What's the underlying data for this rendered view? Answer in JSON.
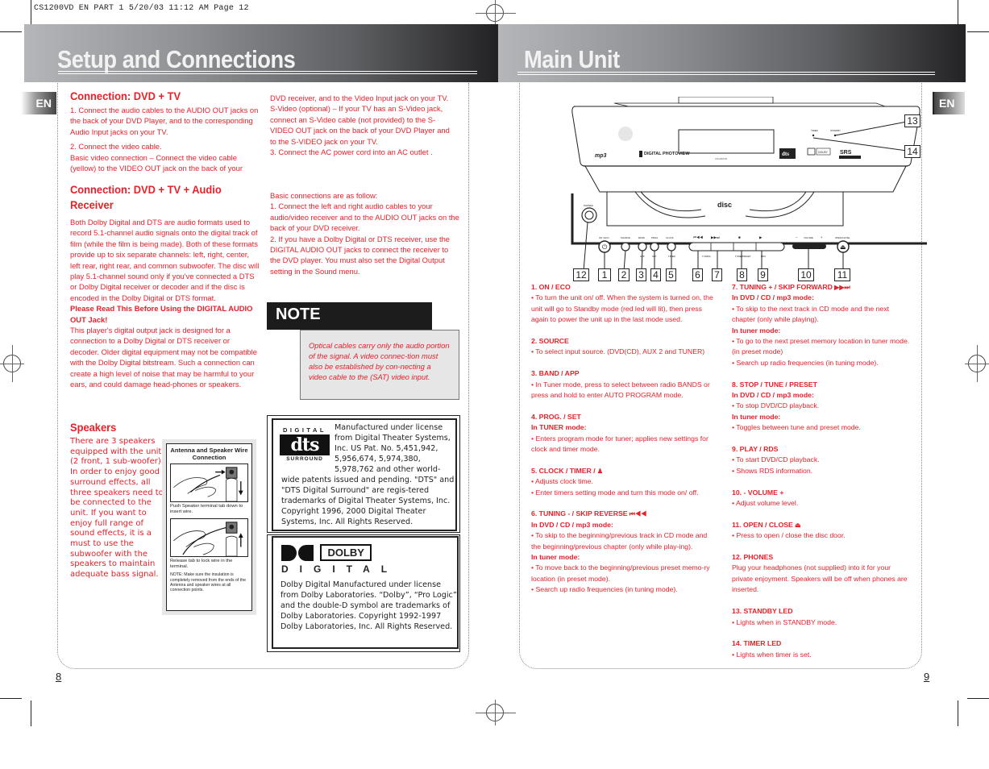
{
  "slug": "CS1200VD EN PART 1  5/20/03  11:12 AM  Page 12",
  "left_page": {
    "title": "Setup and Connections",
    "lang_tab": "EN",
    "page_number": "8",
    "dvd_tv": {
      "heading": "Connection: DVD + TV",
      "step1": "1.  Connect the audio cables to the AUDIO OUT jacks on the back of your DVD Player, and to the corresponding Audio Input jacks on your TV.",
      "step2_title": "2. Connect the video cable.",
      "step2_body": "Basic video connection – Connect the video cable (yellow) to the VIDEO OUT jack on the back of your",
      "cont_1": "DVD receiver, and to the Video Input jack on your TV.",
      "cont_2": "S-Video (optional) – If your TV has an S-Video jack, connect an S-Video cable (not provided) to the S-VIDEO OUT jack on the back of your DVD Player and to the S-VIDEO jack on your TV.",
      "cont_3": "3. Connect the AC power cord into an AC outlet ."
    },
    "dvd_tv_audio": {
      "heading_line1": "Connection: DVD + TV + Audio",
      "heading_line2": "Receiver",
      "body": "Both Dolby Digital and DTS are audio formats used to record 5.1-channel audio signals onto the digital track of film (while the film is being made). Both of these formats provide up to six separate channels: left, right, center, left rear, right rear, and common subwoofer. The disc will play 5.1-channel sound only if you've connected a DTS or Dolby Digital receiver or decoder and if the disc is encoded in the Dolby Digital or DTS format.",
      "warning_title": "Please Read This Before Using the DIGITAL AUDIO OUT Jack!",
      "warning_body": "This player's digital output jack is designed for a connection to a Dolby Digital or DTS receiver or decoder. Older digital equipment may not be compatible with the Dolby Digital bitstream. Such a connection can create a high level of noise that may be harmful to your ears, and could damage head-phones or speakers.",
      "basic_title": "Basic connections are as follow:",
      "basic_1": "1. Connect the left and right audio cables to your audio/video receiver and to the AUDIO OUT jacks on the back of your DVD receiver.",
      "basic_2": "2. If you have a Dolby Digital or DTS receiver, use the DIGITAL AUDIO OUT jacks to connect the receiver to the DVD player. You must also set the Digital Output setting in the Sound menu."
    },
    "note": {
      "label": "NOTE",
      "text": "Optical cables carry only the audio portion of the signal. A video connec-tion must also be established by con-necting a video cable to the (SAT) video input."
    },
    "speakers": {
      "heading": "Speakers",
      "body": "There are 3 speakers equipped with the unit (2 front, 1 sub-woofer).  In order to enjoy good surround effects, all three speakers need to be connected to the unit. If you want to enjoy full range of sound effects, it is a must to use the subwoofer with the  speakers to maintain adequate bass signal."
    },
    "wire_box": {
      "title": "Antenna and Speaker Wire Connection",
      "caption1": "Push Speaker terminal tab down to insert wire.",
      "caption2": "Release tab to lock wire in the terminal.",
      "note": "NOTE: Make sure the insulation is completely removed from the ends of the Antenna and speaker wires at all connection points."
    },
    "dts_license": {
      "logo_top": "DIGITAL",
      "logo_mid": "dts",
      "logo_bottom": "SURROUND",
      "text_top": "Manufactured under license from Digital Theater Systems, Inc. US Pat. No. 5,451,942, 5,956,674, 5,974,380, 5,978,762 and other world-",
      "text_bottom": "wide patents issued and pending. \"DTS\" and \"DTS Digital Surround\" are regis-tered trademarks of Digital Theater Systems, Inc. Copyright 1996, 2000 Digital Theater Systems, Inc. All Rights Reserved."
    },
    "dolby_license": {
      "logo_word": "DOLBY",
      "logo_digital": "DIGITAL",
      "text": "Dolby Digital Manufactured under license from Dolby Laboratories. “Dolby”, “Pro Logic”  and the double-D symbol are trademarks of Dolby Laboratories. Copyright 1992-1997 Dolby Laboratories, Inc. All Rights Reserved."
    }
  },
  "right_page": {
    "title": "Main Unit",
    "lang_tab": "EN",
    "page_number": "9",
    "callouts": [
      "1",
      "2",
      "3",
      "4",
      "5",
      "6",
      "7",
      "8",
      "9",
      "10",
      "11",
      "12",
      "13",
      "14"
    ],
    "device_labels": {
      "on_eco": "ON / ECO",
      "source": "SOURCE",
      "band": "BAND",
      "prog": "PROG",
      "clock": "CLOCK",
      "app": "APP",
      "set": "SET",
      "timer": "TIMER",
      "tuning": "TUNING",
      "tune_preset": "TUNE/PRESET",
      "rds": "RDS",
      "volume": "VOLUME",
      "open_close": "OPEN/CLOSE",
      "phones": "PHONES",
      "timer_led": "TIMER",
      "standby_led": "STANDBY",
      "mp3": "mp3",
      "digital_photoview": "DIGITAL PHOTOVIEW",
      "dts": "dts",
      "dolby": "DOLBY",
      "srs": "SRS",
      "model": "CS1200VD",
      "compact_disc": "disc"
    },
    "items": [
      {
        "title": "1. ON / ECO",
        "lines": [
          {
            "type": "text",
            "text": "• To turn the unit on/ off. When the system is turned on, the unit will go to Standby mode (red led will lit), then press again to power the unit up in the last mode used."
          }
        ]
      },
      {
        "title": "2. SOURCE",
        "lines": [
          {
            "type": "text",
            "text": "• To select input  source.  (DVD(CD), AUX 2 and TUNER)"
          }
        ]
      },
      {
        "title": "3.  BAND / APP",
        "lines": [
          {
            "type": "text",
            "text": "• In Tuner mode, press to select between radio BANDS or press and hold to enter AUTO PROGRAM mode."
          }
        ]
      },
      {
        "title": "4.  PROG. / SET",
        "lines": [
          {
            "type": "sub",
            "text": "In TUNER mode:"
          },
          {
            "type": "text",
            "text": "• Enters program mode for tuner; applies new settings for clock and timer mode."
          }
        ]
      },
      {
        "title": "5.  CLOCK / TIMER /",
        "icon": "timer",
        "lines": [
          {
            "type": "text",
            "text": "• Adjusts clock time."
          },
          {
            "type": "text",
            "text": "• Enter timers setting mode and turn this mode on/ off."
          }
        ]
      },
      {
        "title": "6. TUNING -  / SKIP REVERSE",
        "icon": "skip-reverse",
        "lines": [
          {
            "type": "sub",
            "text": "In DVD / CD / mp3 mode:"
          },
          {
            "type": "text",
            "text": "• To skip to the beginning/previous track in CD mode and the beginning/previous chapter (only while play-ing)."
          },
          {
            "type": "sub",
            "text": "In tuner mode:"
          },
          {
            "type": "text",
            "text": "• To move back to the beginning/previous preset memo-ry location (in preset mode)."
          },
          {
            "type": "text",
            "text": "• Search up radio frequencies (in tuning mode)."
          }
        ]
      },
      {
        "title": "7.  TUNING + / SKIP FORWARD",
        "icon": "skip-forward",
        "lines": [
          {
            "type": "sub",
            "text": "In DVD / CD / mp3 mode:"
          },
          {
            "type": "text",
            "text": "• To skip to the next track in CD mode and the next chapter (only while playing)."
          },
          {
            "type": "sub",
            "text": "In tuner mode:"
          },
          {
            "type": "text",
            "text": "• To go to the next preset memory location in tuner mode. (in preset mode)"
          },
          {
            "type": "text",
            "text": "• Search up radio frequencies (in tuning mode)."
          }
        ]
      },
      {
        "title": "8.  STOP / TUNE / PRESET",
        "lines": [
          {
            "type": "sub",
            "text": "In DVD / CD / mp3 mode:"
          },
          {
            "type": "text",
            "text": "• To stop DVD/CD playback."
          },
          {
            "type": "sub",
            "text": "In tuner mode:"
          },
          {
            "type": "text",
            "text": "• Toggles between tune and preset mode."
          }
        ]
      },
      {
        "title": "9.  PLAY / RDS",
        "lines": [
          {
            "type": "text",
            "text": "• To start DVD/CD playback."
          },
          {
            "type": "text",
            "text": "• Shows RDS information."
          }
        ]
      },
      {
        "title": "10.  - VOLUME +",
        "lines": [
          {
            "type": "text",
            "text": "• Adjust volume level."
          }
        ]
      },
      {
        "title": "11. OPEN / CLOSE",
        "icon": "eject",
        "lines": [
          {
            "type": "text",
            "text": "• Press to open / close the disc door."
          }
        ]
      },
      {
        "title": "12.  PHONES",
        "lines": [
          {
            "type": "text",
            "text": "Plug your headphones (not supplied) into it  for your private enjoyment. Speakers will be off when phones are inserted."
          }
        ]
      },
      {
        "title": "13.  STANDBY LED",
        "lines": [
          {
            "type": "text",
            "text": "• Lights when in STANDBY mode."
          }
        ]
      },
      {
        "title": "14.  TIMER LED",
        "lines": [
          {
            "type": "text",
            "text": " • Lights when timer is set."
          }
        ]
      }
    ]
  }
}
